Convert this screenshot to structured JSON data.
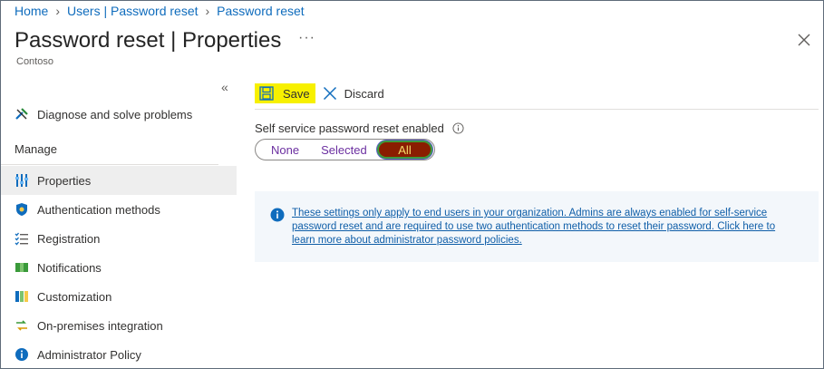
{
  "breadcrumb": {
    "items": [
      "Home",
      "Users | Password reset",
      "Password reset"
    ]
  },
  "header": {
    "title": "Password reset | Properties",
    "more": "···",
    "subtitle": "Contoso"
  },
  "sidebar": {
    "collapse_glyph": "«",
    "top_item": {
      "label": "Diagnose and solve problems",
      "icon": "wrench-icon"
    },
    "section_label": "Manage",
    "items": [
      {
        "label": "Properties",
        "icon": "properties-icon",
        "active": true
      },
      {
        "label": "Authentication methods",
        "icon": "shield-icon",
        "active": false
      },
      {
        "label": "Registration",
        "icon": "checklist-icon",
        "active": false
      },
      {
        "label": "Notifications",
        "icon": "notification-icon",
        "active": false
      },
      {
        "label": "Customization",
        "icon": "customization-icon",
        "active": false
      },
      {
        "label": "On-premises integration",
        "icon": "sync-icon",
        "active": false
      },
      {
        "label": "Administrator Policy",
        "icon": "info-icon",
        "active": false
      }
    ]
  },
  "toolbar": {
    "save_label": "Save",
    "discard_label": "Discard"
  },
  "sspr": {
    "label": "Self service password reset enabled",
    "options": [
      "None",
      "Selected",
      "All"
    ],
    "selected": "All"
  },
  "banner": {
    "text": "These settings only apply to end users in your organization. Admins are always enabled for self-service password reset and are required to use two authentication methods to reset their password. Click here to learn more about administrator password policies."
  },
  "colors": {
    "link": "#0f6cbd",
    "save_highlight": "#f7f000",
    "toggle_selected_bg": "#8a1d00",
    "toggle_selected_text": "#f5dd6a",
    "option_text": "#6b2fa0",
    "banner_bg": "#f3f7fb"
  }
}
